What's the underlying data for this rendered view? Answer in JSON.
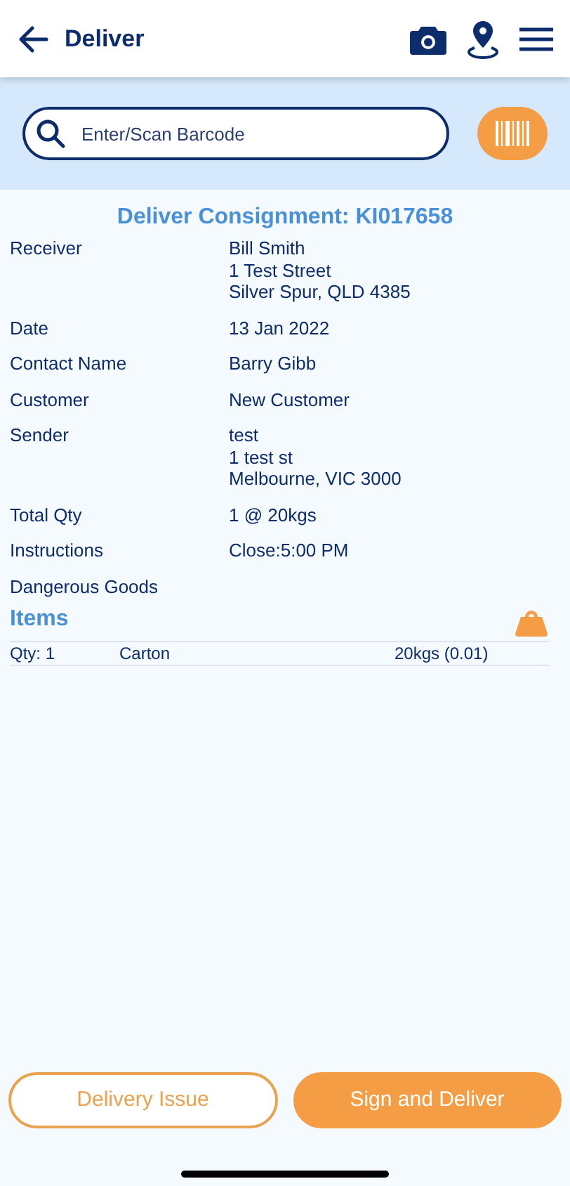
{
  "header": {
    "title": "Deliver"
  },
  "search": {
    "placeholder": "Enter/Scan Barcode"
  },
  "title": "Deliver Consignment: KI017658",
  "details": [
    {
      "label": "Receiver",
      "lines": [
        "Bill Smith",
        "1 Test Street",
        "Silver Spur, QLD 4385"
      ]
    },
    {
      "label": "Date",
      "lines": [
        "13 Jan 2022"
      ]
    },
    {
      "label": "Contact Name",
      "lines": [
        "Barry Gibb"
      ]
    },
    {
      "label": "Customer",
      "lines": [
        "New Customer"
      ]
    },
    {
      "label": "Sender",
      "lines": [
        "test",
        "1 test st",
        "Melbourne, VIC 3000"
      ]
    },
    {
      "label": "Total Qty",
      "lines": [
        "1 @ 20kgs"
      ]
    },
    {
      "label": "Instructions",
      "lines": [
        "Close:5:00 PM"
      ]
    },
    {
      "label": "Dangerous Goods"
    }
  ],
  "items": {
    "heading": "Items",
    "rows": [
      {
        "qty": "Qty: 1",
        "type": "Carton",
        "weight": "20kgs (0.01)"
      }
    ]
  },
  "buttons": [
    {
      "label": "Delivery Issue",
      "kind": "outline"
    },
    {
      "label": "Sign and Deliver",
      "kind": "filled"
    }
  ]
}
